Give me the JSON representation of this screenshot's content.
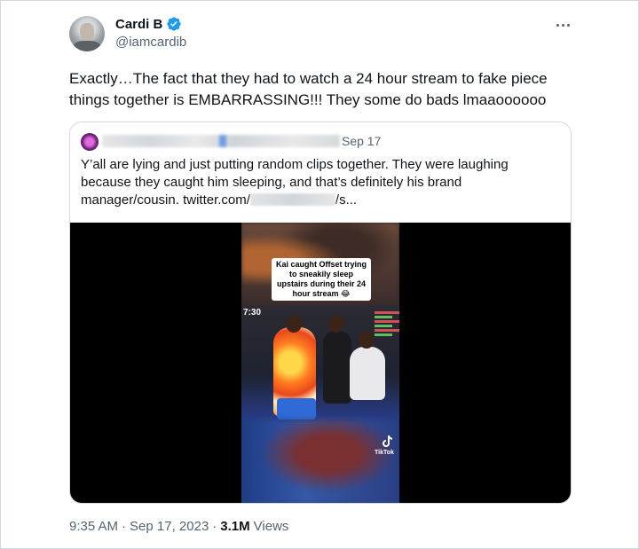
{
  "author": {
    "name": "Cardi B",
    "handle": "@iamcardib",
    "verified_icon": "verified-badge-icon",
    "accent": "#1d9bf0"
  },
  "tweet": {
    "text": "Exactly…The fact that they had to watch a 24 hour stream to fake piece things together is EMBARRASSING!!! They some do bads lmaaoooooo"
  },
  "quoted": {
    "date": "Sep 17",
    "text_before": "Y’all are lying and just putting random clips together. They were laughing because they caught him sleeping, and that’s definitely his brand manager/cousin.  twitter.com/",
    "text_after": "/s..."
  },
  "video": {
    "caption": "Kai caught Offset trying to sneakily sleep upstairs during their 24 hour stream 😂",
    "timestamp": "7:30",
    "brand": "TikTok"
  },
  "footer": {
    "time": "9:35 AM",
    "sep1": "·",
    "date": "Sep 17, 2023",
    "sep2": "·",
    "views_count": "3.1M",
    "views_label": "Views"
  }
}
